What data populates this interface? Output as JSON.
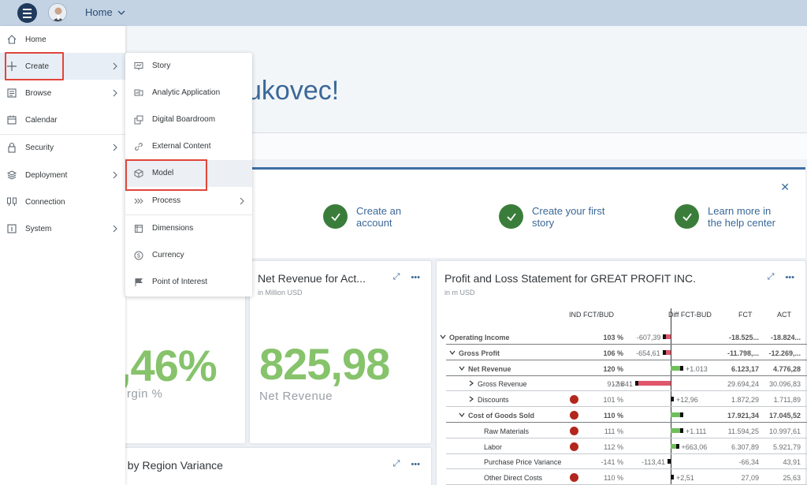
{
  "shell": {
    "home_label": "Home"
  },
  "welcome": {
    "text": "ukovec!"
  },
  "get_started": {
    "items": [
      {
        "label": "Create an account"
      },
      {
        "label": "Create your first story"
      },
      {
        "label": "Learn more in the help center"
      }
    ]
  },
  "tiles": {
    "margin": {
      "value": ",46%",
      "label": "rgin %"
    },
    "net_revenue": {
      "title": "Net Revenue for Act...",
      "subtitle": "in Million USD",
      "value": "825,98",
      "label": "Net Revenue"
    },
    "region": {
      "title": "t by Region Variance"
    },
    "pl": {
      "title": "Profit and Loss Statement for GREAT PROFIT INC.",
      "subtitle": "in m USD",
      "headers": {
        "ind": "IND FCT/BUD",
        "diff": "Diff FCT-BUD",
        "fct": "FCT",
        "act": "ACT"
      },
      "rows": [
        {
          "label": "Operating Income",
          "pct": "103 %",
          "diff": "-607,39",
          "fct": "-18.525...",
          "act": "-18.824...",
          "diff_value": -607.39
        },
        {
          "label": "Gross Profit",
          "pct": "106 %",
          "diff": "-654,61",
          "fct": "-11.798,...",
          "act": "-12.269,...",
          "diff_value": -654.61
        },
        {
          "label": "Net Revenue",
          "pct": "120 %",
          "diff": "+1.013",
          "fct": "6.123,17",
          "act": "4.776,28",
          "diff_value": 1013
        },
        {
          "label": "Gross Revenue",
          "pct": "91 %",
          "diff": "-2.841",
          "fct": "29.694,24",
          "act": "30.096,83",
          "diff_value": -2841
        },
        {
          "label": "Discounts",
          "pct": "101 %",
          "diff": "+12,96",
          "fct": "1.872,29",
          "act": "1.711,89",
          "diff_value": 12.96
        },
        {
          "label": "Cost of Goods Sold",
          "pct": "110 %",
          "diff": "",
          "fct": "17.921,34",
          "act": "17.045,52",
          "diff_value": 1500
        },
        {
          "label": "Raw Materials",
          "pct": "111 %",
          "diff": "+1.111",
          "fct": "11.594,25",
          "act": "10.997,61",
          "diff_value": 1111
        },
        {
          "label": "Labor",
          "pct": "112 %",
          "diff": "+663,06",
          "fct": "6.307,89",
          "act": "5.921,79",
          "diff_value": 663.06
        },
        {
          "label": "Purchase Price Variance",
          "pct": "-141 %",
          "diff": "-113,41",
          "fct": "-66,34",
          "act": "43,91",
          "diff_value": -113.41
        },
        {
          "label": "Other Direct Costs",
          "pct": "110 %",
          "diff": "+2,51",
          "fct": "27,09",
          "act": "25,63",
          "diff_value": 2.51
        }
      ]
    }
  },
  "sidebar": {
    "items": [
      {
        "label": "Home",
        "icon": "home-icon"
      },
      {
        "label": "Create",
        "icon": "plus-icon"
      },
      {
        "label": "Browse",
        "icon": "browse-icon"
      },
      {
        "label": "Calendar",
        "icon": "calendar-icon"
      },
      {
        "label": "Security",
        "icon": "lock-icon"
      },
      {
        "label": "Deployment",
        "icon": "deployment-icon"
      },
      {
        "label": "Connection",
        "icon": "connection-icon"
      },
      {
        "label": "System",
        "icon": "system-icon"
      }
    ]
  },
  "flyout": {
    "items": [
      {
        "label": "Story",
        "icon": "story-icon"
      },
      {
        "label": "Analytic Application",
        "icon": "analytic-application-icon"
      },
      {
        "label": "Digital Boardroom",
        "icon": "digital-boardroom-icon"
      },
      {
        "label": "External Content",
        "icon": "link-icon"
      },
      {
        "label": "Model",
        "icon": "cube-icon"
      },
      {
        "label": "Process",
        "icon": "process-icon"
      },
      {
        "label": "Dimensions",
        "icon": "dimensions-icon"
      },
      {
        "label": "Currency",
        "icon": "currency-icon"
      },
      {
        "label": "Point of Interest",
        "icon": "flag-icon"
      }
    ]
  },
  "colors": {
    "accent": "#3b6897",
    "kpi_green": "#86c36b",
    "highlight_red": "#e0463a",
    "check_green": "#3a7d3a",
    "negative_bar": "#e0566b",
    "positive_bar": "#6fbf5a"
  }
}
